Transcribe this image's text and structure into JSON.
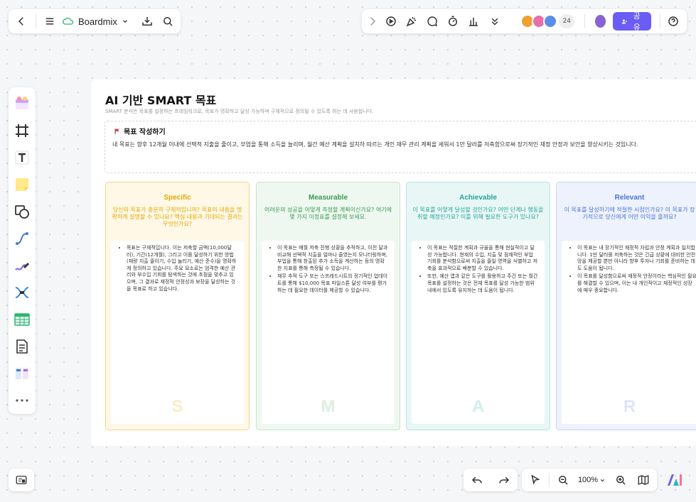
{
  "app": {
    "name": "Boardmix"
  },
  "toolbar_right": {
    "avatar_count": "24",
    "share_label": "공유"
  },
  "board": {
    "title": "AI 기반 SMART 목표",
    "subtitle": "SMART 분석은 목표를 설정하는 프레임워크로, 목표가 명확하고 달성 가능하며 구체적으로 정의될 수 있도록 하는 데 사용됩니다.",
    "goal": {
      "heading": "목표 작성하기",
      "text": "내 목표는 향후 12개월 이내에 선택적 지출을 줄이고, 부업을 통해 소득을 늘리며, 월간 예산 계획을 설치하 따르는 개인 재무 관리 계획을 세워서 1만 달러를 저축함으로써 장기적인 재정 안정과 보안을 향상시키는 것입니다."
    },
    "cards": [
      {
        "title": "Specific",
        "question": "당신의 목표가 충분히 구체적입니까? 목표의 내용을 명확하게 설명할 수 있나요? 핵심 내용과 기대되는 결과는 무엇인가요?",
        "bullets": [
          "목표는 구체적입니다. 이는 저축할 금액(10,000달러), 기간(12개월), 그리고 이를 달성하기 위한 방법(재량 지출 줄이기, 수입 늘리기, 예산 준수)을 명확하게 정의하고 있습니다. 주요 요소로는 엄격한 예산 관리와 부수입 기회를 탐색하는 것에 초점을 맞추고 있으며, 그 결과로 재정적 안정성과 보장을 달성하는 것을 목표로 하고 있습니다."
        ],
        "letter": "S"
      },
      {
        "title": "Measurable",
        "question": "어려운의 성공을 어떻게 측정할 계획이신가요? 여기에 몇 가지 이정표를 설정해 보세요.",
        "bullets": [
          "이 목표는 매월 저축 진행 상황을 추적하고, 이전 달과 비교해 선택적 지출을 얼마나 줄였는지 모니터링하며, 부업을 통해 창출된 추가 소득을 계산하는 등의 명확한 지표를 통해 측정될 수 있습니다.",
          "재무 추적 도구 또는 스프레드시트의 정기적인 업데이트를 통해 $10,000 목표 마일스톤 달성 여부를 평가하는 데 필요한 데이터를 제공할 수 있습니다."
        ],
        "letter": "M"
      },
      {
        "title": "Achievable",
        "question": "이 목표를 어떻게 달성할 것인가요? 어떤 단계나 행동을 취할 예정인가요? 이를 위해 필요한 도구가 있나요?",
        "bullets": [
          "이 목표는 적절한 계획과 규율을 통해 현실적이고 달성 가능합니다. 현재의 수입, 지출 및 잠재적인 부업 기회를 분석함으로써 지출을 줄일 영역을 식별하고 저축을 효과적으로 배분할 수 있습니다.",
          "또한, 예산 앱과 같은 도구를 활용하고 주간 또는 월간 목표를 설정하는 것은 전체 목표를 달성 가능한 범위 내에서 있도록 유지하는 데 도움이 됩니다."
        ],
        "letter": "A"
      },
      {
        "title": "Relevant",
        "question": "이 목표를 달성하기에 적절한 시점인가요? 이 목표가 장기적으로 당신에게 어떤 이익을 줄까요?",
        "bullets": [
          "이 목표는 내 장기적인 재정적 자립과 안정 계획과 일치합니다. 1만 달러를 저축하는 것은 긴급 상황에 대비한 안전망을 제공할 뿐만 아니라 향후 투자나 기회를 준비하는 데도 도움이 됩니다.",
          "이 목표를 달성함으로써 재정적 안정이라는 핵심적인 필요를 해결할 수 있으며, 이는 내 개인적이고 재정적인 성장에 매우 중요합니다."
        ],
        "letter": "R"
      }
    ]
  },
  "zoom": {
    "level": "100%"
  },
  "colors": {
    "accent": "#6b5cf6",
    "specific_bg": "#fff8e6",
    "specific_border": "#f3d488",
    "specific_text": "#e0a800",
    "measurable_bg": "#eef8f0",
    "measurable_border": "#c6e4cc",
    "measurable_text": "#3a9a52",
    "achievable_bg": "#e8f7f6",
    "achievable_border": "#b4e2df",
    "achievable_text": "#28a39a",
    "relevant_bg": "#eef2fc",
    "relevant_border": "#c9d5f3",
    "relevant_text": "#4a74d8"
  }
}
